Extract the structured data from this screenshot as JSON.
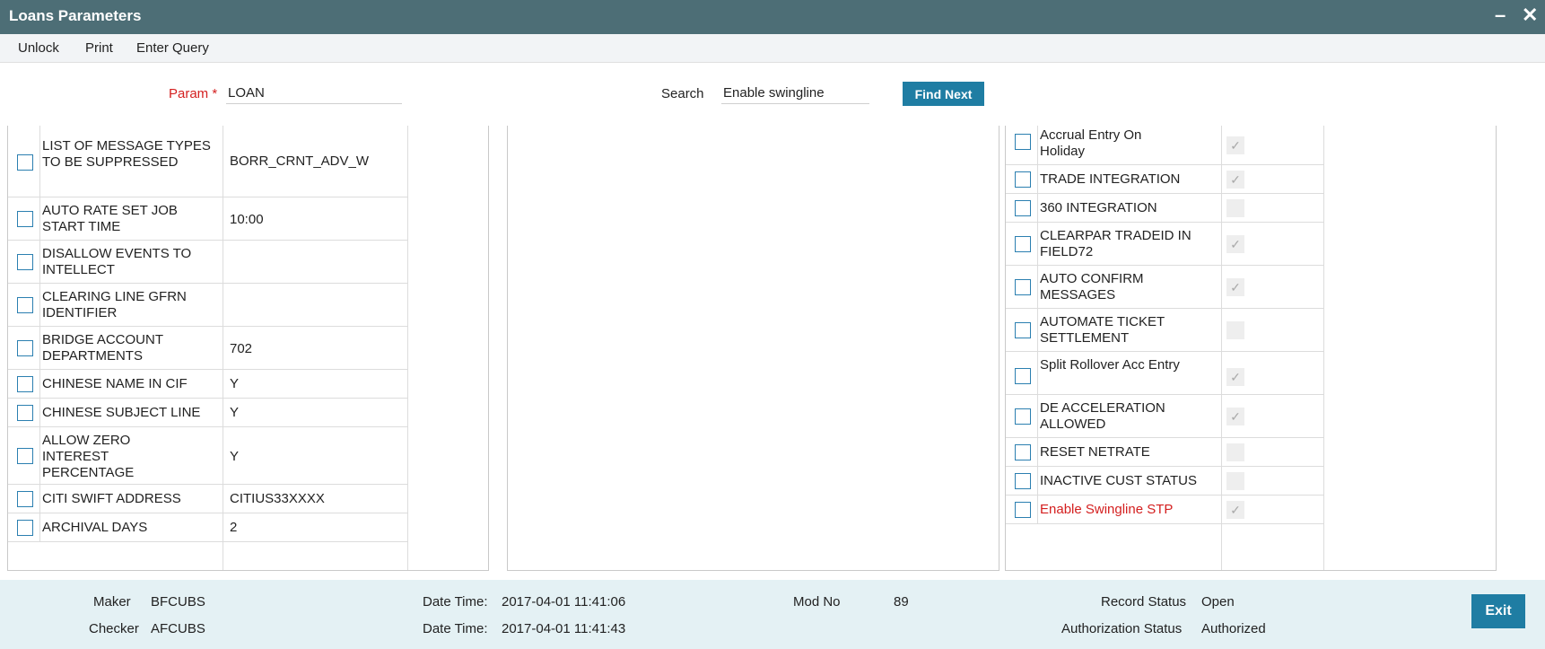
{
  "window": {
    "title": "Loans Parameters",
    "minimize": "–",
    "close": "✕"
  },
  "menu": {
    "unlock": "Unlock",
    "print": "Print",
    "enter_query": "Enter Query"
  },
  "param": {
    "label": "Param *",
    "value": "LOAN"
  },
  "search": {
    "label": "Search",
    "value": "Enable swingline",
    "button": "Find Next"
  },
  "left_rows": [
    {
      "label": "LIST OF MESSAGE TYPES TO BE SUPPRESSED",
      "value": "BORR_CRNT_ADV_W"
    },
    {
      "label": "AUTO RATE SET JOB START TIME",
      "value": "10:00"
    },
    {
      "label": "DISALLOW EVENTS TO INTELLECT",
      "value": ""
    },
    {
      "label": "CLEARING LINE GFRN IDENTIFIER",
      "value": ""
    },
    {
      "label": "BRIDGE ACCOUNT DEPARTMENTS",
      "value": "702"
    },
    {
      "label": "CHINESE NAME IN CIF",
      "value": "Y"
    },
    {
      "label": "CHINESE SUBJECT LINE",
      "value": "Y"
    },
    {
      "label": "ALLOW ZERO INTEREST PERCENTAGE",
      "value": "Y"
    },
    {
      "label": "CITI SWIFT ADDRESS",
      "value": "CITIUS33XXXX"
    },
    {
      "label": "ARCHIVAL DAYS",
      "value": "2"
    }
  ],
  "right_rows": [
    {
      "label": "Accrual Entry On Holiday",
      "checked": true
    },
    {
      "label": "TRADE INTEGRATION",
      "checked": true
    },
    {
      "label": "360 INTEGRATION",
      "checked": false
    },
    {
      "label": "CLEARPAR TRADEID IN FIELD72",
      "checked": true
    },
    {
      "label": "AUTO CONFIRM MESSAGES",
      "checked": true
    },
    {
      "label": "AUTOMATE TICKET SETTLEMENT",
      "checked": false
    },
    {
      "label": "Split Rollover Acc Entry",
      "checked": true
    },
    {
      "label": "DE ACCELERATION ALLOWED",
      "checked": true
    },
    {
      "label": "RESET NETRATE",
      "checked": false
    },
    {
      "label": "INACTIVE CUST STATUS",
      "checked": false
    },
    {
      "label": "Enable Swingline STP",
      "checked": true,
      "highlight": true
    }
  ],
  "footer": {
    "maker_label": "Maker",
    "maker": "BFCUBS",
    "checker_label": "Checker",
    "checker": "AFCUBS",
    "dt_label": "Date Time:",
    "maker_dt": "2017-04-01 11:41:06",
    "checker_dt": "2017-04-01 11:41:43",
    "mod_label": "Mod No",
    "mod_no": "89",
    "record_status_label": "Record Status",
    "record_status": "Open",
    "auth_status_label": "Authorization Status",
    "auth_status": "Authorized",
    "exit": "Exit"
  },
  "colors": {
    "titlebar": "#4d6e76",
    "accent": "#1f7da3",
    "highlight": "#d42020",
    "footer": "#e4f1f4"
  }
}
